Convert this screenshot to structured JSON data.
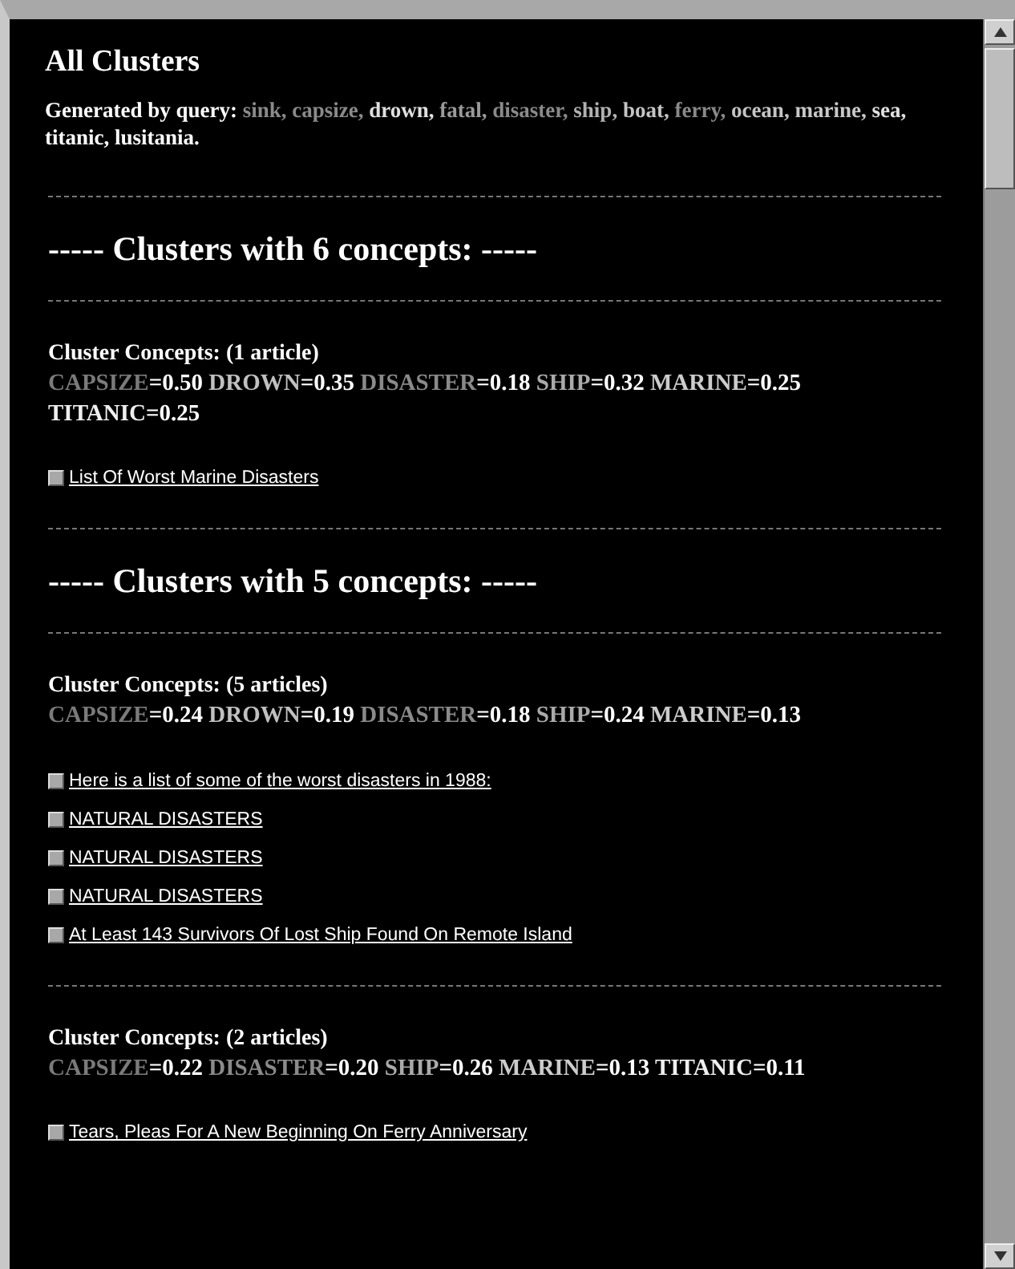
{
  "title": "All Clusters",
  "query": {
    "label": "Generated by query:",
    "terms": [
      {
        "text": "sink,",
        "color": "#8a8a8a"
      },
      {
        "text": "capsize,",
        "color": "#8a8a8a"
      },
      {
        "text": "drown,",
        "color": "#e0e0e0"
      },
      {
        "text": "fatal,",
        "color": "#9a9a9a"
      },
      {
        "text": "disaster,",
        "color": "#8a8a8a"
      },
      {
        "text": "ship,",
        "color": "#b0b0b0"
      },
      {
        "text": "boat,",
        "color": "#c4c4c4"
      },
      {
        "text": "ferry,",
        "color": "#8a8a8a"
      },
      {
        "text": "ocean,",
        "color": "#c4c4c4"
      },
      {
        "text": "marine,",
        "color": "#c8c8c8"
      },
      {
        "text": "sea,",
        "color": "#e0e0e0"
      },
      {
        "text": "titanic,",
        "color": "#ffffff"
      },
      {
        "text": "lusitania.",
        "color": "#ffffff"
      }
    ]
  },
  "sections": [
    {
      "heading": "----- Clusters with 6 concepts: -----",
      "clusters": [
        {
          "label": "Cluster Concepts: (1 article)",
          "concepts": [
            {
              "term": "CAPSIZE",
              "weight": "=0.50",
              "color": "#7a7a7a"
            },
            {
              "term": "DROWN",
              "weight": "=0.35",
              "color": "#c0c0c0"
            },
            {
              "term": "DISASTER",
              "weight": "=0.18",
              "color": "#8a8a8a"
            },
            {
              "term": "SHIP",
              "weight": "=0.32",
              "color": "#aaaaaa"
            },
            {
              "term": "MARINE",
              "weight": "=0.25",
              "color": "#cccccc"
            },
            {
              "term": "TITANIC",
              "weight": "=0.25",
              "color": "#eeeeee"
            }
          ],
          "articles": [
            "List Of Worst Marine Disasters"
          ]
        }
      ]
    },
    {
      "heading": "----- Clusters with 5 concepts: -----",
      "clusters": [
        {
          "label": "Cluster Concepts: (5 articles)",
          "concepts": [
            {
              "term": "CAPSIZE",
              "weight": "=0.24",
              "color": "#7a7a7a"
            },
            {
              "term": "DROWN",
              "weight": "=0.19",
              "color": "#c0c0c0"
            },
            {
              "term": "DISASTER",
              "weight": "=0.18",
              "color": "#8a8a8a"
            },
            {
              "term": "SHIP",
              "weight": "=0.24",
              "color": "#aaaaaa"
            },
            {
              "term": "MARINE",
              "weight": "=0.13",
              "color": "#cccccc"
            }
          ],
          "articles": [
            "Here is a list of some of the worst disasters in 1988:",
            "NATURAL DISASTERS",
            "NATURAL DISASTERS",
            "NATURAL DISASTERS",
            "At Least 143 Survivors Of Lost Ship Found On Remote Island"
          ]
        },
        {
          "label": "Cluster Concepts: (2 articles)",
          "concepts": [
            {
              "term": "CAPSIZE",
              "weight": "=0.22",
              "color": "#7a7a7a"
            },
            {
              "term": "DISASTER",
              "weight": "=0.20",
              "color": "#8a8a8a"
            },
            {
              "term": "SHIP",
              "weight": "=0.26",
              "color": "#aaaaaa"
            },
            {
              "term": "MARINE",
              "weight": "=0.13",
              "color": "#cccccc"
            },
            {
              "term": "TITANIC",
              "weight": "=0.11",
              "color": "#eeeeee"
            }
          ],
          "articles": [
            "Tears, Pleas For A New Beginning On Ferry Anniversary"
          ]
        }
      ]
    }
  ]
}
